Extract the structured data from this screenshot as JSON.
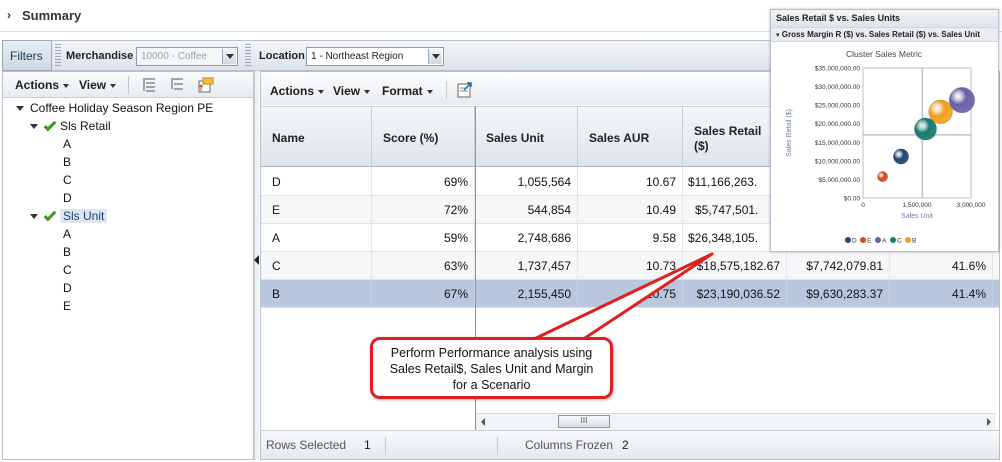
{
  "summary": {
    "title": "Summary"
  },
  "filters": {
    "tab_label": "Filters",
    "merchandise_label": "Merchandise",
    "merchandise_value": "10000 - Coffee",
    "location_label": "Location",
    "location_value": "1 - Northeast Region"
  },
  "left_toolbar": {
    "actions": "Actions",
    "view": "View"
  },
  "tree": {
    "root": "Coffee Holiday Season Region PE",
    "groups": [
      {
        "label": "Sls Retail",
        "items": [
          "A",
          "B",
          "C",
          "D"
        ]
      },
      {
        "label": "Sls Unit",
        "items": [
          "A",
          "B",
          "C",
          "D",
          "E"
        ]
      }
    ]
  },
  "grid_toolbar": {
    "actions": "Actions",
    "view": "View",
    "format": "Format"
  },
  "grid": {
    "columns": [
      "Name",
      "Score (%)",
      "Sales Unit",
      "Sales AUR",
      "Sales Retail ($)"
    ],
    "rows": [
      {
        "name": "D",
        "score": "69%",
        "sales_unit": "1,055,564",
        "aur": "10.67",
        "retail": "$11,166,263.",
        "col6": "",
        "col7": ""
      },
      {
        "name": "E",
        "score": "72%",
        "sales_unit": "544,854",
        "aur": "10.49",
        "retail": "$5,747,501.",
        "col6": "",
        "col7": ""
      },
      {
        "name": "A",
        "score": "59%",
        "sales_unit": "2,748,686",
        "aur": "9.58",
        "retail": "$26,348,105.",
        "col6": "",
        "col7": ""
      },
      {
        "name": "C",
        "score": "63%",
        "sales_unit": "1,737,457",
        "aur": "10.73",
        "retail": "$18,575,182.67",
        "col6": "$7,742,079.81",
        "col7": "41.6%"
      },
      {
        "name": "B",
        "score": "67%",
        "sales_unit": "2,155,450",
        "aur": "10.75",
        "retail": "$23,190,036.52",
        "col6": "$9,630,283.37",
        "col7": "41.4%"
      }
    ]
  },
  "status": {
    "rows_selected_label": "Rows Selected",
    "rows_selected": "1",
    "columns_frozen_label": "Columns Frozen",
    "columns_frozen": "2"
  },
  "scroll": {
    "thumb": "III"
  },
  "callout": {
    "line1": "Perform Performance analysis using",
    "line2": "Sales Retail$, Sales Unit and Margin",
    "line3": "for a Scenario"
  },
  "chart_panel": {
    "title": "Sales Retail $ vs. Sales Units",
    "subtitle": "Gross Margin R ($) vs. Sales Retail ($) vs. Sales Unit"
  },
  "chart_data": {
    "type": "scatter",
    "title": "Cluster Sales Metric",
    "xlabel": "Sales Unit",
    "ylabel": "Sales Retail ($)",
    "xlim": [
      0,
      3000000
    ],
    "ylim": [
      0,
      35000000
    ],
    "x_ticks": [
      "0",
      "1,500,000",
      "3,000,000"
    ],
    "y_ticks": [
      "$0.00",
      "$5,000,000.00",
      "$10,000,000.00",
      "$15,000,000.00",
      "$20,000,000.00",
      "$25,000,000.00",
      "$30,000,000.00",
      "$35,000,000.00"
    ],
    "series": [
      {
        "name": "D",
        "color": "#24466e",
        "x": 1055564,
        "y": 11166263,
        "r": 0.45
      },
      {
        "name": "E",
        "color": "#d8481c",
        "x": 544854,
        "y": 5747501,
        "r": 0.3
      },
      {
        "name": "A",
        "color": "#6c5fa8",
        "x": 2748686,
        "y": 26348105,
        "r": 0.75
      },
      {
        "name": "C",
        "color": "#1a7a6e",
        "x": 1737457,
        "y": 18575183,
        "r": 0.65
      },
      {
        "name": "B",
        "color": "#f0a020",
        "x": 2155450,
        "y": 23190037,
        "r": 0.7
      }
    ]
  }
}
